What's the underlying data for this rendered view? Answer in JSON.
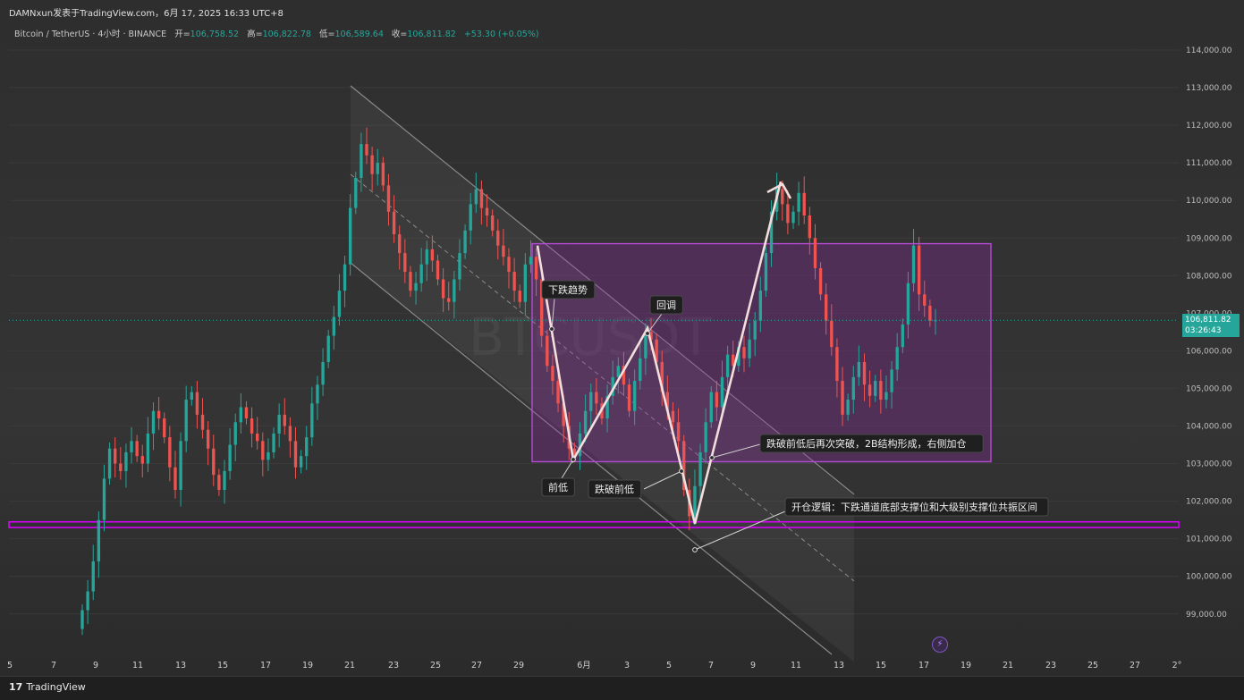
{
  "header": {
    "attribution": "DAMNxun发表于TradingView.com，6月 17, 2025 16:33 UTC+8"
  },
  "legend": {
    "symbol": "Bitcoin / TetherUS · 4小时 · BINANCE",
    "open_label": "开=",
    "open": "106,758.52",
    "high_label": "高=",
    "high": "106,822.78",
    "low_label": "低=",
    "low": "106,589.64",
    "close_label": "收=",
    "close": "106,811.82",
    "change": "+53.30 (+0.05%)"
  },
  "price_tag": {
    "price": "106,811.82",
    "countdown": "03:26:43"
  },
  "watermark": "BTCUSDT",
  "footer": {
    "brand": "TradingView",
    "brand_mark": "𝟭𝟳"
  },
  "colors": {
    "up": "#26a69a",
    "down": "#ef5350",
    "zone": "#9c27b0",
    "support": "#d500f9",
    "arrow": "#f3dede"
  },
  "chart_data": {
    "type": "candlestick",
    "symbol": "BTCUSDT",
    "ylim": [
      98500,
      114500
    ],
    "y_ticks": [
      99000,
      100000,
      101000,
      102000,
      103000,
      104000,
      105000,
      106000,
      107000,
      108000,
      109000,
      110000,
      111000,
      112000,
      113000,
      114000
    ],
    "y_tick_labels": [
      "99,000.00",
      "100,000.00",
      "101,000.00",
      "102,000.00",
      "103,000.00",
      "104,000.00",
      "105,000.00",
      "106,000.00",
      "107,000.00",
      "108,000.00",
      "109,000.00",
      "110,000.00",
      "111,000.00",
      "112,000.00",
      "113,000.00",
      "114,000.00"
    ],
    "x_tick_labels": [
      "5",
      "7",
      "9",
      "11",
      "13",
      "15",
      "17",
      "19",
      "21",
      "23",
      "25",
      "27",
      "29",
      "6月",
      "3",
      "5",
      "7",
      "9",
      "11",
      "13",
      "15",
      "17",
      "19",
      "21",
      "23",
      "25",
      "27",
      "2°"
    ],
    "last_price": 106811.82,
    "closes": [
      99100,
      99600,
      100400,
      101500,
      102600,
      103400,
      103000,
      102800,
      103300,
      103600,
      103200,
      103000,
      103800,
      104400,
      104200,
      103700,
      102900,
      102300,
      103600,
      104700,
      104900,
      104300,
      103900,
      103400,
      102700,
      102300,
      102800,
      103500,
      104100,
      104500,
      104200,
      103800,
      103600,
      103100,
      103300,
      103800,
      104300,
      104000,
      103600,
      102900,
      103200,
      103700,
      104600,
      105100,
      105700,
      106400,
      106900,
      107600,
      108300,
      109800,
      110600,
      111500,
      111200,
      110700,
      111000,
      110400,
      109700,
      109100,
      108600,
      108100,
      107600,
      107800,
      108300,
      108700,
      108400,
      107900,
      107400,
      107300,
      107900,
      108600,
      109200,
      109900,
      110300,
      109800,
      109600,
      109200,
      108800,
      108500,
      108100,
      107600,
      107300,
      108300,
      108500,
      107900,
      106400,
      105600,
      105200,
      104600,
      104000,
      103400,
      103200,
      103800,
      104400,
      104900,
      104600,
      104200,
      104800,
      105300,
      105600,
      105100,
      104400,
      105200,
      105800,
      106500,
      106300,
      105700,
      104900,
      104400,
      104100,
      103600,
      102300,
      101600,
      102400,
      103300,
      104100,
      104900,
      104500,
      105300,
      105900,
      105600,
      106100,
      105800,
      106300,
      106800,
      107600,
      108600,
      109700,
      110300,
      109900,
      109400,
      109700,
      110200,
      109600,
      109000,
      108200,
      107500,
      106800,
      106100,
      105200,
      104300,
      104700,
      105300,
      105700,
      105100,
      104800,
      105200,
      104700,
      104900,
      105500,
      106100,
      106700,
      107800,
      108800,
      107500,
      107200,
      106800,
      106812
    ],
    "annotations": {
      "price_labels": [
        "下跌趋势",
        "回调",
        "前低",
        "跌破前低",
        "跌破前低后再次突破，2B结构形成，右侧加仓",
        "开仓逻辑：下跌通道底部支撑位和大级别支撑位共振区间"
      ],
      "zone": {
        "top": 108850,
        "bottom": 103050
      },
      "support_band": {
        "top": 101450,
        "bottom": 101300
      },
      "channel_upper": [
        {
          "date": "5月20",
          "price": 113000
        },
        {
          "date": "6月13",
          "price": 102300
        }
      ],
      "channel_lower": [
        {
          "date": "5月20",
          "price": 108300
        },
        {
          "date": "6月13",
          "price": 98800
        }
      ],
      "arrow_path": [
        {
          "label": "start",
          "price": 108800
        },
        {
          "label": "前低",
          "price": 103100
        },
        {
          "label": "回调",
          "price": 106600
        },
        {
          "label": "跌破前低",
          "price": 101400
        },
        {
          "label": "peak",
          "price": 110500
        }
      ]
    }
  }
}
